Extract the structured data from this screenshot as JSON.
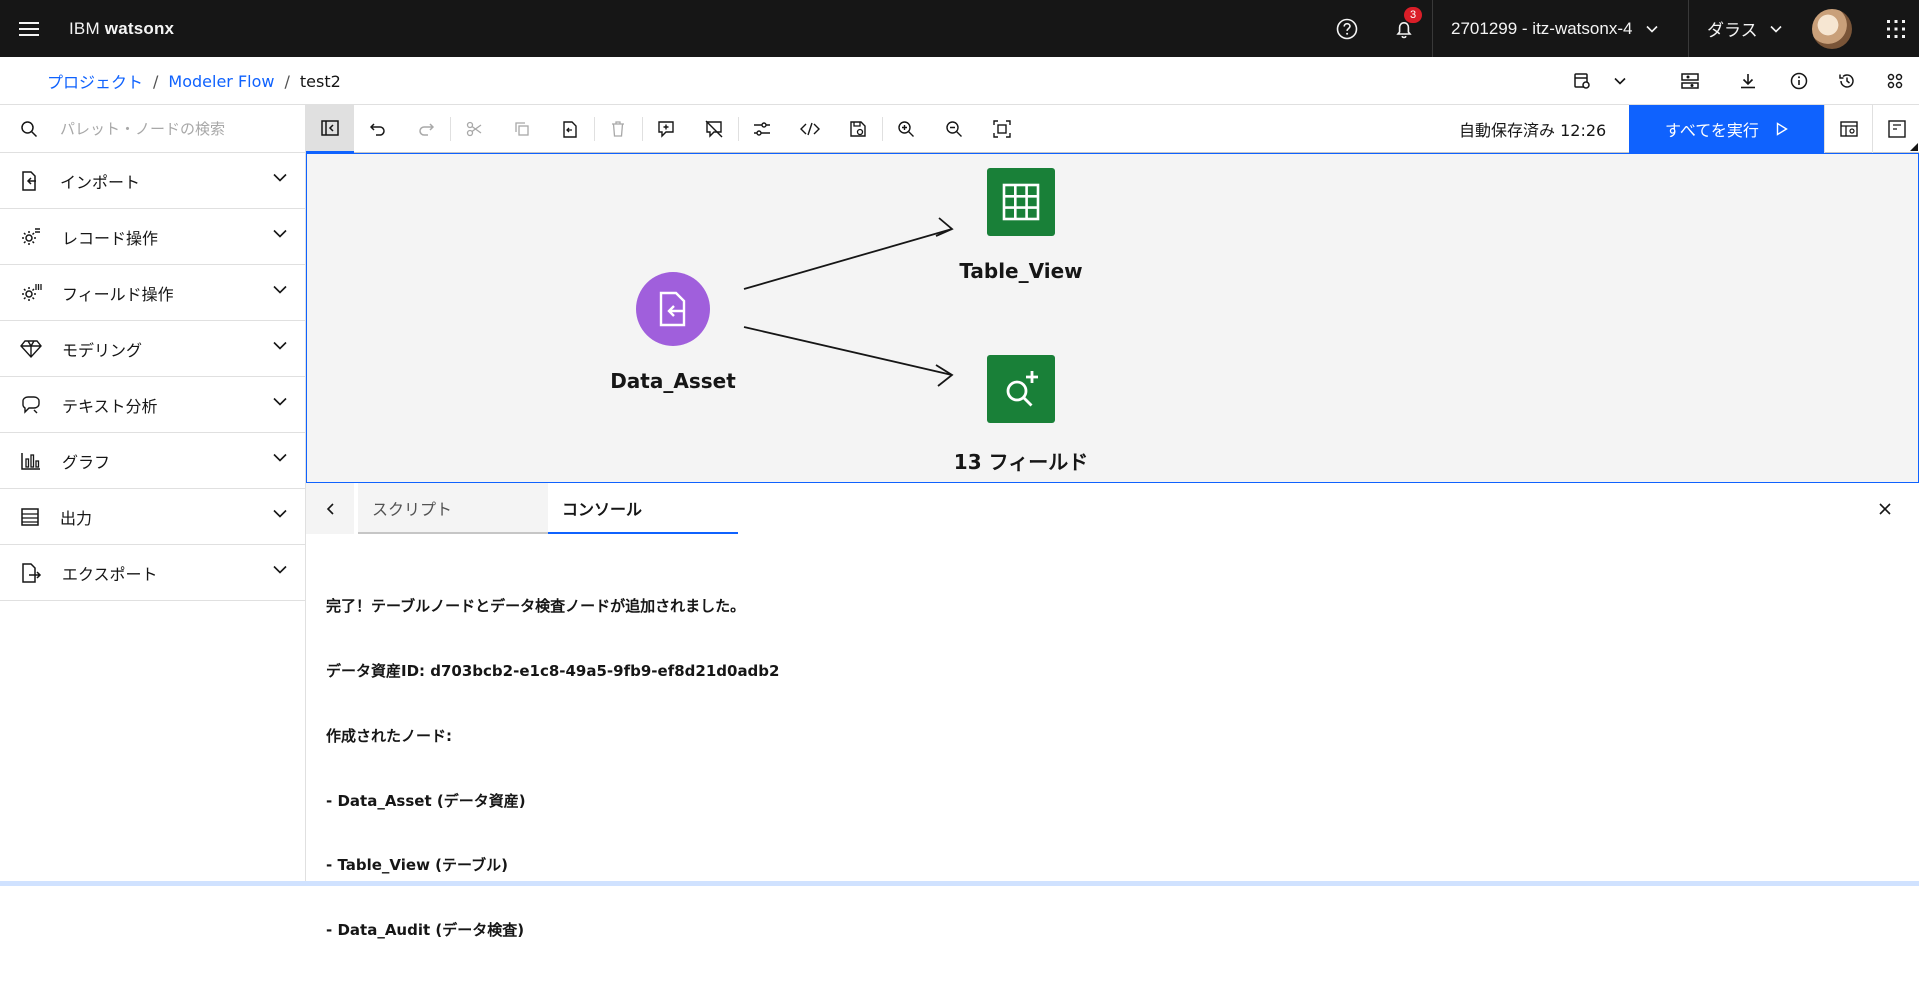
{
  "app": {
    "brand_prefix": "IBM",
    "brand_name": "watsonx",
    "notification_count": "3",
    "account": "2701299 - itz-watsonx-4",
    "region": "ダラス"
  },
  "breadcrumb": {
    "items": [
      "プロジェクト",
      "Modeler Flow"
    ],
    "current": "test2"
  },
  "palette": {
    "search_placeholder": "パレット・ノードの検索",
    "items": [
      {
        "label": "インポート",
        "icon": "import-icon"
      },
      {
        "label": "レコード操作",
        "icon": "record-ops-icon"
      },
      {
        "label": "フィールド操作",
        "icon": "field-ops-icon"
      },
      {
        "label": "モデリング",
        "icon": "diamond-icon"
      },
      {
        "label": "テキスト分析",
        "icon": "text-analysis-icon"
      },
      {
        "label": "グラフ",
        "icon": "bar-chart-icon"
      },
      {
        "label": "出力",
        "icon": "table-list-icon"
      },
      {
        "label": "エクスポート",
        "icon": "export-icon"
      }
    ]
  },
  "toolbar": {
    "autosave": "自動保存済み 12:26",
    "run_all": "すべてを実行"
  },
  "canvas": {
    "nodes": [
      {
        "label": "Data_Asset",
        "type": "data-asset",
        "color": "#a05fdc"
      },
      {
        "label": "Table_View",
        "type": "table",
        "color": "#198038"
      },
      {
        "label": "13 フィールド",
        "type": "data-audit",
        "color": "#198038"
      }
    ]
  },
  "bottom_panel": {
    "tabs": [
      "スクリプト",
      "コンソール"
    ],
    "active_tab": "コンソール",
    "console_lines": [
      "完了！テーブルノードとデータ検査ノードが追加されました。",
      "データ資産ID: d703bcb2-e1c8-49a5-9fb9-ef8d21d0adb2",
      "作成されたノード:",
      "- Data_Asset (データ資産)",
      "- Table_View (テーブル)",
      "- Data_Audit (データ検査)"
    ]
  },
  "colors": {
    "accent": "#0f62fe",
    "topbar": "#161616",
    "badge": "#da1e28",
    "data_asset_node": "#a05fdc",
    "process_node": "#198038"
  }
}
